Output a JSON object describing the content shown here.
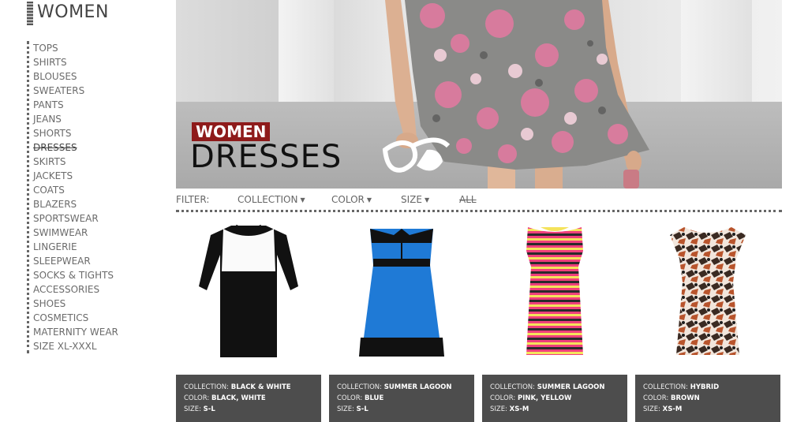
{
  "sidebar": {
    "title": "WOMEN",
    "items": [
      {
        "label": "TOPS"
      },
      {
        "label": "SHIRTS"
      },
      {
        "label": "BLOUSES"
      },
      {
        "label": "SWEATERS"
      },
      {
        "label": "PANTS"
      },
      {
        "label": "JEANS"
      },
      {
        "label": "SHORTS"
      },
      {
        "label": "DRESSES",
        "active": true
      },
      {
        "label": "SKIRTS"
      },
      {
        "label": "JACKETS"
      },
      {
        "label": "COATS"
      },
      {
        "label": "BLAZERS"
      },
      {
        "label": "SPORTSWEAR"
      },
      {
        "label": "SWIMWEAR"
      },
      {
        "label": "LINGERIE"
      },
      {
        "label": "SLEEPWEAR"
      },
      {
        "label": "SOCKS & TIGHTS"
      },
      {
        "label": "ACCESSORIES"
      },
      {
        "label": "SHOES"
      },
      {
        "label": "COSMETICS"
      },
      {
        "label": "MATERNITY WEAR"
      },
      {
        "label": "SIZE XL-XXXL"
      }
    ]
  },
  "hero": {
    "badge": "WOMEN",
    "category": "DRESSES"
  },
  "filter": {
    "label": "FILTER:",
    "collection": "COLLECTION",
    "color": "COLOR",
    "size": "SIZE",
    "all": "ALL"
  },
  "product_field_labels": {
    "collection": "COLLECTION:",
    "color": "COLOR:",
    "size": "SIZE:"
  },
  "products": [
    {
      "collection": "BLACK & WHITE",
      "color": "BLACK, WHITE",
      "size": "S-L",
      "image": "black-white-dress"
    },
    {
      "collection": "SUMMER LAGOON",
      "color": "BLUE",
      "size": "S-L",
      "image": "blue-strapless-dress"
    },
    {
      "collection": "SUMMER LAGOON",
      "color": "PINK, YELLOW",
      "size": "XS-M",
      "image": "striped-dress"
    },
    {
      "collection": "HYBRID",
      "color": "BROWN",
      "size": "XS-M",
      "image": "print-dress"
    }
  ],
  "colors": {
    "accent": "#8e1b1b",
    "info_bg": "#4d4d4d"
  }
}
